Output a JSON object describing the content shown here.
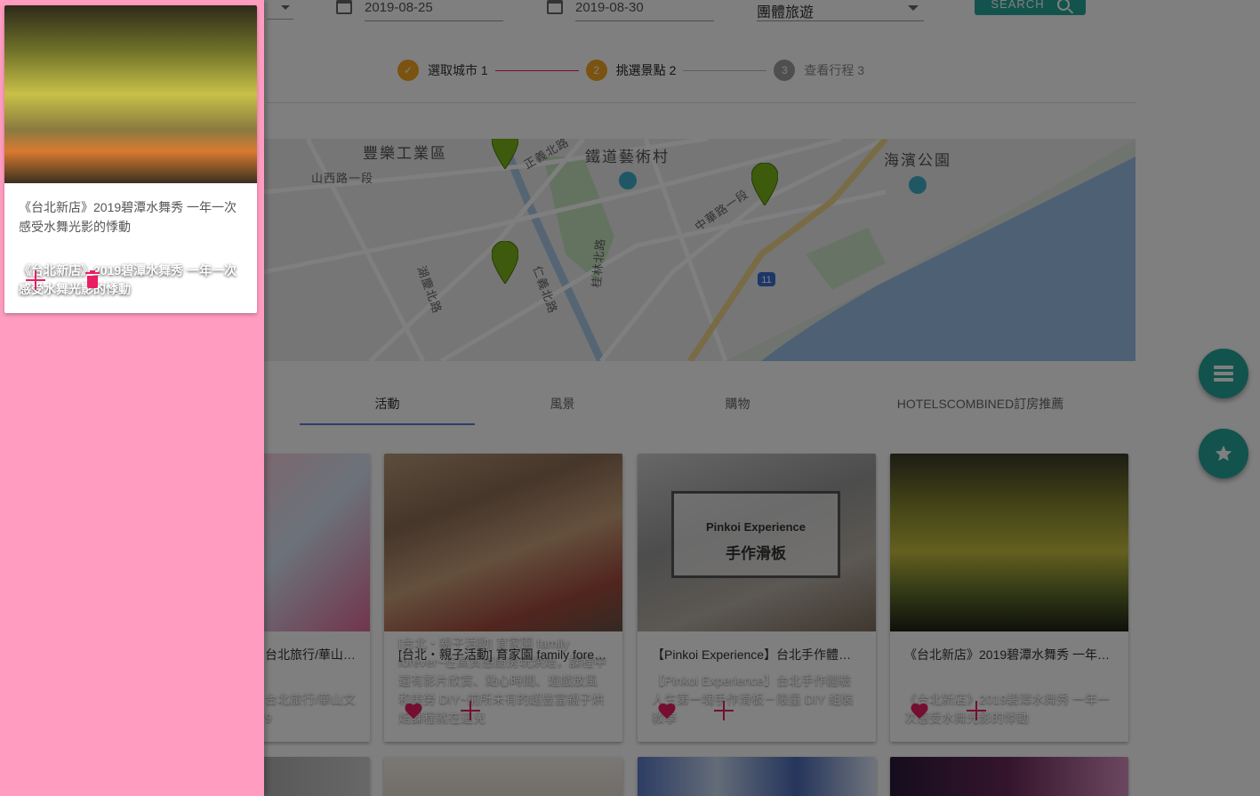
{
  "search": {
    "start_date": "2019-08-25",
    "end_date": "2019-08-30",
    "trip_type": "團體旅遊",
    "button_label": "SEARCH"
  },
  "stepper": {
    "steps": [
      {
        "label": "選取城市 1",
        "state": "done",
        "marker": "✓"
      },
      {
        "label": "挑選景點 2",
        "state": "active",
        "marker": "2"
      },
      {
        "label": "查看行程 3",
        "state": "pending",
        "marker": "3"
      }
    ]
  },
  "map": {
    "labels": [
      "豐樂工業區",
      "鐵道藝術村",
      "海濱公園",
      "山西路一段",
      "中華路一段",
      "仁義北路",
      "桂林北路",
      "湖慶北路",
      "正義北路"
    ],
    "route_marker": "11"
  },
  "tabs": [
    "活動",
    "風景",
    "購物",
    "HOTELSCOMBINED訂房推薦"
  ],
  "cards": [
    {
      "image_title": "台北旅行/華山文\n9",
      "content": "台北旅行/華山…"
    },
    {
      "image_title": "[台北・親子活動] 育家園 family forever~在高質感廚房玩烘焙，課程中還有影片欣賞、點心時間、遊戲放風和美勞 DIY~前所未有的超豐富親子烘焙課程就在這兒",
      "content": "[台北・親子活動] 育家園 family fore…"
    },
    {
      "image_title": "【Pinkoi Experience】台北手作體驗 人生第一塊手作滑板－限量 DIY 組裝教學",
      "content": "【Pinkoi Experience】台北手作體驗…",
      "image_sign_1": "Pinkoi Experience",
      "image_sign_2": "手作滑板"
    },
    {
      "image_title": "《台北新店》2019碧潭水舞秀 一年一次感受水舞光影的悸動",
      "content": "《台北新店》2019碧潭水舞秀 一年…"
    }
  ],
  "drawer": {
    "image_title": "《台北新店》2019碧潭水舞秀 一年一次感受水舞光影的悸動",
    "content": "《台北新店》2019碧潭水舞秀 一年一次感受水舞光影的悸動"
  },
  "colors": {
    "accent": "#e91e63",
    "fab": "#26a69a",
    "drawer_bg": "#ff9cc0",
    "step_done": "#f5a623",
    "step_pending": "#9e9e9e",
    "tab_indicator": "#5c7dd8"
  },
  "icons": {
    "fab_top": "list-icon",
    "fab_bottom": "star-icon",
    "card_like": "heart-icon",
    "card_add": "plus-icon",
    "drawer_delete": "trash-icon"
  }
}
